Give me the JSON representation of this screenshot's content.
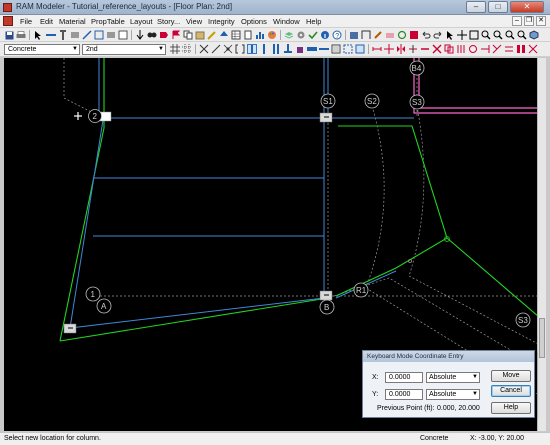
{
  "window": {
    "title": "RAM Modeler - Tutorial_reference_layouts - [Floor Plan: 2nd]",
    "minimize": "–",
    "maximize": "□",
    "close": "✕"
  },
  "menu": [
    "File",
    "Edit",
    "Material",
    "PropTable",
    "Layout",
    "Story...",
    "View",
    "Integrity",
    "Options",
    "Window",
    "Help"
  ],
  "mdi_controls": [
    "–",
    "❐",
    "✕"
  ],
  "selectors": {
    "material": "Concrete",
    "story": "2nd"
  },
  "toolbar1_icons": [
    "save-icon",
    "print-icon",
    "select-icon",
    "beam-icon",
    "column-icon",
    "wall-icon",
    "brace-icon",
    "grid-icon",
    "find-icon",
    "zoom-icon",
    "pan-icon"
  ],
  "plan": {
    "grid_bubbles": [
      "2",
      "S1",
      "S2",
      "S3",
      "B4",
      "1",
      "A",
      "R1",
      "B",
      "S3"
    ],
    "colors": {
      "background": "#000000",
      "beam": "#3f88d6",
      "wall": "#22d322",
      "wall_pink": "#ff66cc",
      "gridline": "#9a9a9a",
      "column": "#d9d9d9"
    }
  },
  "dialog": {
    "title": "Keyboard Mode Coordinate Entry",
    "x_label": "X:",
    "x_value": "0.0000",
    "x_mode": "Absolute",
    "y_label": "Y:",
    "y_value": "0.0000",
    "y_mode": "Absolute",
    "previous_point_label": "Previous Point (ft):",
    "previous_point_value": "0.000, 20.000",
    "move_button": "Move",
    "cancel_button": "Cancel",
    "help_button": "Help"
  },
  "status": {
    "message": "Select new location for column.",
    "material": "Concrete",
    "coords": "X:  -3.00,  Y:  20.00"
  }
}
